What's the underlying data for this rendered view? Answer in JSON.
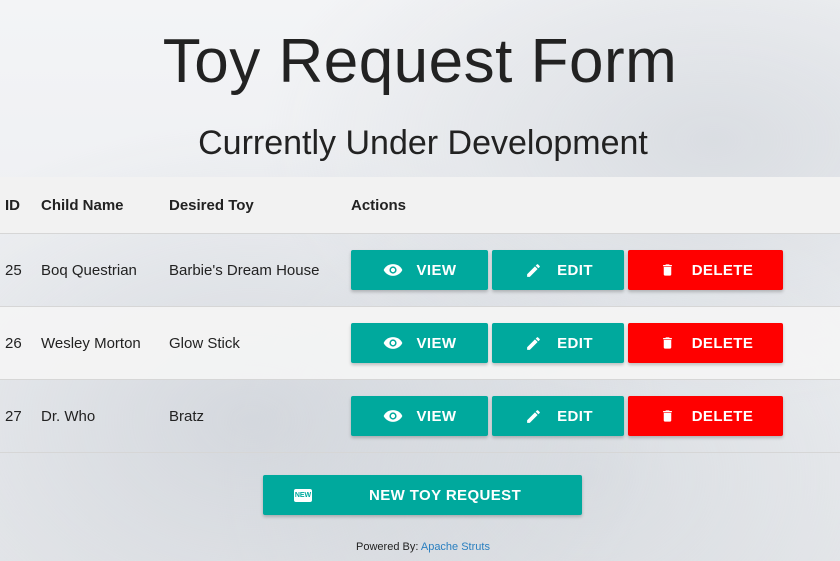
{
  "header": {
    "title": "Toy Request Form",
    "subtitle": "Currently Under Development"
  },
  "table": {
    "columns": [
      "ID",
      "Child Name",
      "Desired Toy",
      "Actions"
    ],
    "rows": [
      {
        "id": "25",
        "child_name": "Boq Questrian",
        "desired_toy": "Barbie's Dream House"
      },
      {
        "id": "26",
        "child_name": "Wesley Morton",
        "desired_toy": "Glow Stick"
      },
      {
        "id": "27",
        "child_name": "Dr. Who",
        "desired_toy": "Bratz"
      }
    ],
    "actions": {
      "view_label": "VIEW",
      "edit_label": "EDIT",
      "delete_label": "DELETE",
      "view_icon": "eye-icon",
      "edit_icon": "pencil-icon",
      "delete_icon": "trash-icon"
    }
  },
  "new_request": {
    "label": "NEW TOY REQUEST",
    "icon": "new-icon",
    "icon_text": "NEW"
  },
  "footer": {
    "prefix": "Powered By:",
    "link_text": "Apache Struts"
  },
  "colors": {
    "primary": "#00a99d",
    "danger": "#ff0000"
  }
}
